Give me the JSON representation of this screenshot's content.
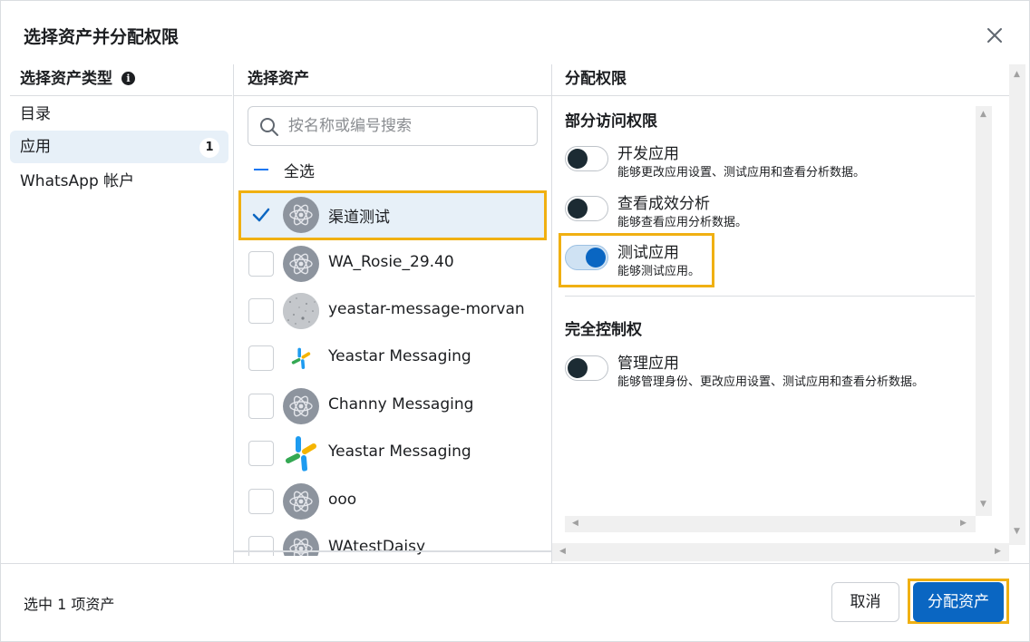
{
  "dialog": {
    "title": "选择资产并分配权限"
  },
  "asset_types": {
    "header": "选择资产类型",
    "items": [
      {
        "label": "目录"
      },
      {
        "label": "应用",
        "count": "1"
      },
      {
        "label": "WhatsApp 帐户"
      }
    ]
  },
  "assets": {
    "header": "选择资产",
    "search_placeholder": "按名称或编号搜索",
    "select_all_label": "全选",
    "items": [
      {
        "name": "渠道测试",
        "checked": true,
        "icon": "atom-icon"
      },
      {
        "name": "WA_Rosie_29.40",
        "checked": false,
        "icon": "atom-icon"
      },
      {
        "name": "yeastar-message-morvan",
        "checked": false,
        "icon": "noise-image"
      },
      {
        "name": "Yeastar Messaging",
        "checked": false,
        "icon": "yeastar-logo"
      },
      {
        "name": "Channy Messaging",
        "checked": false,
        "icon": "atom-icon"
      },
      {
        "name": "Yeastar Messaging",
        "checked": false,
        "icon": "yeastar-logo"
      },
      {
        "name": "ooo",
        "checked": false,
        "icon": "atom-icon"
      },
      {
        "name": "WAtestDaisy",
        "checked": false,
        "icon": "atom-icon"
      }
    ]
  },
  "permissions": {
    "header": "分配权限",
    "partial": {
      "title": "部分访问权限",
      "items": [
        {
          "name": "开发应用",
          "desc": "能够更改应用设置、测试应用和查看分析数据。",
          "on": false
        },
        {
          "name": "查看成效分析",
          "desc": "能够查看应用分析数据。",
          "on": false
        },
        {
          "name": "测试应用",
          "desc": "能够测试应用。",
          "on": true
        }
      ]
    },
    "full": {
      "title": "完全控制权",
      "items": [
        {
          "name": "管理应用",
          "desc": "能够管理身份、更改应用设置、测试应用和查看分析数据。",
          "on": false
        }
      ]
    }
  },
  "footer": {
    "selected_text": "选中 1 项资产",
    "cancel_label": "取消",
    "assign_label": "分配资产"
  },
  "colors": {
    "accent": "#0a66c2",
    "highlight": "#f0b012",
    "selected_bg": "#e7f0f8"
  }
}
